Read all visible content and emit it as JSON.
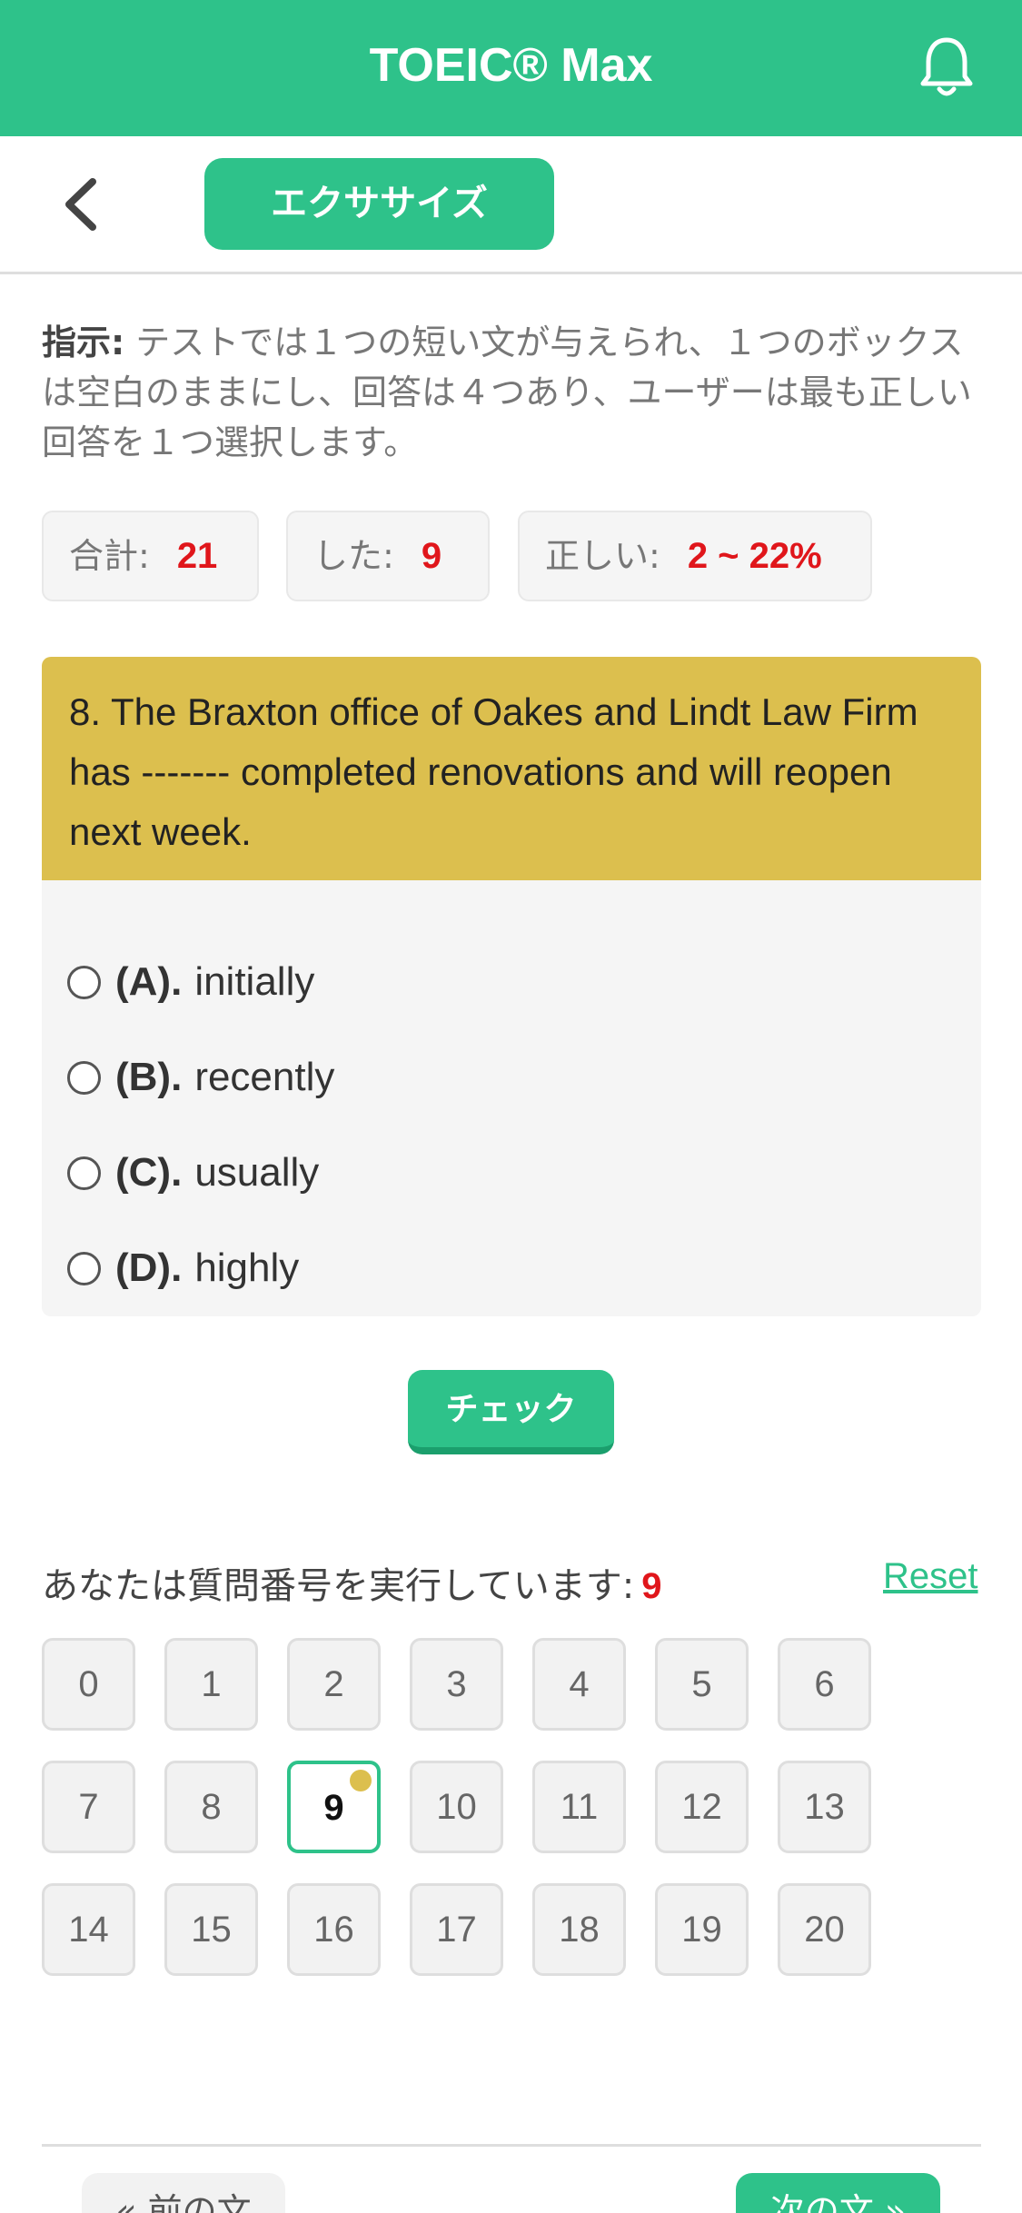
{
  "header": {
    "title": "TOEIC® Max",
    "icon": "bell-icon"
  },
  "subheader": {
    "back_icon": "chevron-left-icon",
    "tab_label": "エクササイズ"
  },
  "instruction": {
    "label": "指示:",
    "text": " テストでは１つの短い文が与えられ、１つのボックスは空白のままにし、回答は４つあり、ユーザーは最も正しい回答を１つ選択します。"
  },
  "stats": {
    "total_label": "合計:",
    "total_value": "21",
    "done_label": "した:",
    "done_value": "9",
    "correct_label": "正しい:",
    "correct_value": "2 ~ 22%"
  },
  "question": {
    "text": "8. The Braxton office of Oakes and Lindt Law Firm has ------- completed renovations and will reopen next week.",
    "options": [
      {
        "letter": "(A).",
        "text": "initially"
      },
      {
        "letter": "(B).",
        "text": "recently"
      },
      {
        "letter": "(C).",
        "text": "usually"
      },
      {
        "letter": "(D).",
        "text": "highly"
      }
    ]
  },
  "check_label": "チェック",
  "progress": {
    "label": "あなたは質問番号を実行しています:",
    "current": "9",
    "reset_label": "Reset"
  },
  "question_numbers": [
    "0",
    "1",
    "2",
    "3",
    "4",
    "5",
    "6",
    "7",
    "8",
    "9",
    "10",
    "11",
    "12",
    "13",
    "14",
    "15",
    "16",
    "17",
    "18",
    "19",
    "20"
  ],
  "current_index": 9,
  "nav": {
    "prev_label": "« 前の文",
    "next_label": "次の文 »"
  },
  "colors": {
    "accent": "#2ec28a",
    "question_bg": "#dcbf4e",
    "highlight": "#e0161b"
  }
}
